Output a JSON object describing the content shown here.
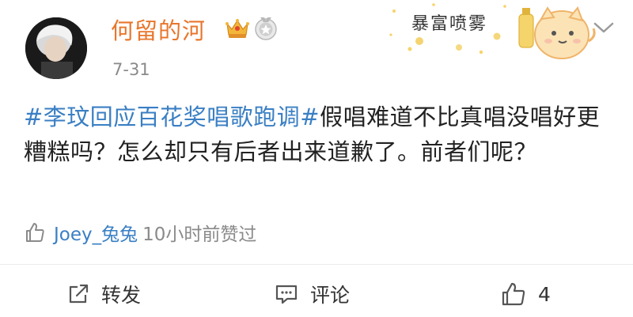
{
  "post": {
    "author": {
      "name": "何留的河",
      "avatar_icon": "avatar-photo",
      "badges": [
        "crown-badge-icon",
        "medal-badge-icon"
      ]
    },
    "timestamp": "7-31",
    "decoration_text": "暴富喷雾",
    "body": {
      "hashtag1": "#李玟回应百花奖唱歌跑调#",
      "text": "假唱难道不比真唱没唱好更糟糕吗？怎么却只有后者出来道歉了。前者们呢？"
    },
    "likers": {
      "name": "Joey_兔兔",
      "suffix": "10小时前赞过"
    },
    "actions": {
      "repost_label": "转发",
      "comment_label": "评论",
      "like_count": "4"
    },
    "colors": {
      "username": "#e8762c",
      "link": "#3a7fc4",
      "meta": "#8a8a8a"
    }
  }
}
